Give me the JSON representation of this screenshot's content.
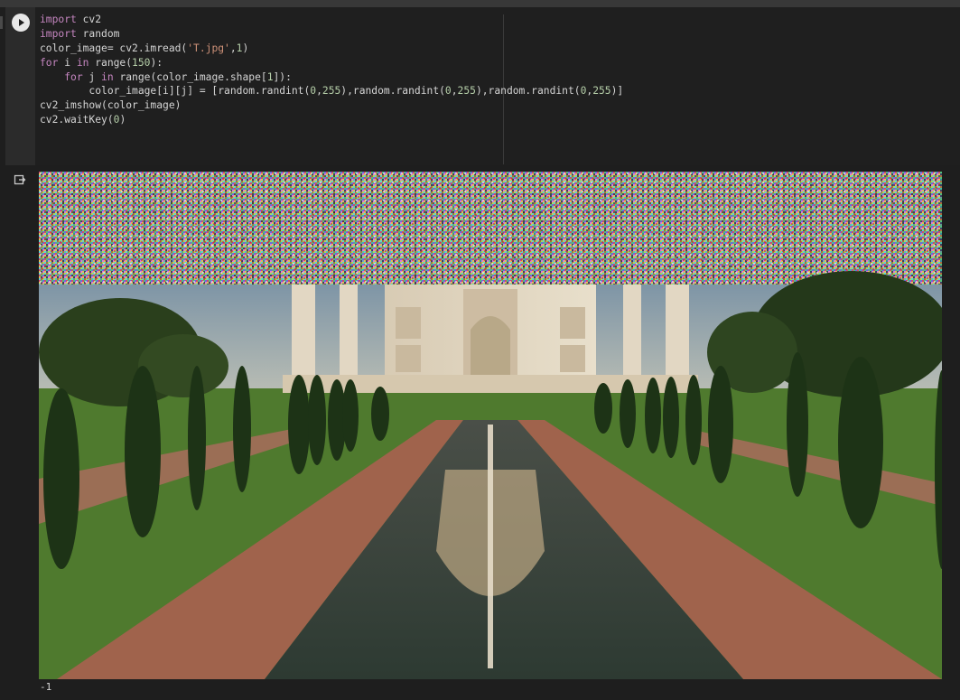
{
  "code_cell": {
    "run_button_label": "Run cell",
    "lines": [
      [
        {
          "t": "import",
          "c": "kw"
        },
        {
          "t": " cv2",
          "c": "fn"
        }
      ],
      [
        {
          "t": "import",
          "c": "kw"
        },
        {
          "t": " random",
          "c": "fn"
        }
      ],
      [
        {
          "t": "color_image= cv2.imread(",
          "c": "fn"
        },
        {
          "t": "'T.jpg'",
          "c": "str"
        },
        {
          "t": ",",
          "c": "fn"
        },
        {
          "t": "1",
          "c": "num"
        },
        {
          "t": ")",
          "c": "fn"
        }
      ],
      [
        {
          "t": "for",
          "c": "kw"
        },
        {
          "t": " i ",
          "c": "fn"
        },
        {
          "t": "in",
          "c": "kw"
        },
        {
          "t": " range(",
          "c": "fn"
        },
        {
          "t": "150",
          "c": "num"
        },
        {
          "t": "):",
          "c": "fn"
        }
      ],
      [
        {
          "t": "    ",
          "c": "fn"
        },
        {
          "t": "for",
          "c": "kw"
        },
        {
          "t": " j ",
          "c": "fn"
        },
        {
          "t": "in",
          "c": "kw"
        },
        {
          "t": " range(color_image.shape[",
          "c": "fn"
        },
        {
          "t": "1",
          "c": "num"
        },
        {
          "t": "]):",
          "c": "fn"
        }
      ],
      [
        {
          "t": "        color_image[i][j] = [random.randint(",
          "c": "fn"
        },
        {
          "t": "0",
          "c": "num"
        },
        {
          "t": ",",
          "c": "fn"
        },
        {
          "t": "255",
          "c": "num"
        },
        {
          "t": "),random.randint(",
          "c": "fn"
        },
        {
          "t": "0",
          "c": "num"
        },
        {
          "t": ",",
          "c": "fn"
        },
        {
          "t": "255",
          "c": "num"
        },
        {
          "t": "),random.randint(",
          "c": "fn"
        },
        {
          "t": "0",
          "c": "num"
        },
        {
          "t": ",",
          "c": "fn"
        },
        {
          "t": "255",
          "c": "num"
        },
        {
          "t": ")]",
          "c": "fn"
        }
      ],
      [
        {
          "t": "cv2_imshow(color_image)",
          "c": "fn"
        }
      ],
      [
        {
          "t": "cv2.waitKey(",
          "c": "fn"
        },
        {
          "t": "0",
          "c": "num"
        },
        {
          "t": ")",
          "c": "fn"
        }
      ]
    ]
  },
  "output": {
    "icon": "output-icon",
    "image_description_icon": "taj-mahal-output-image",
    "result_text": "-1"
  },
  "colors": {
    "keyword": "#c586c0",
    "string": "#ce9178",
    "number": "#b5cea8",
    "text": "#d4d4d4",
    "background": "#1e1e1e"
  }
}
